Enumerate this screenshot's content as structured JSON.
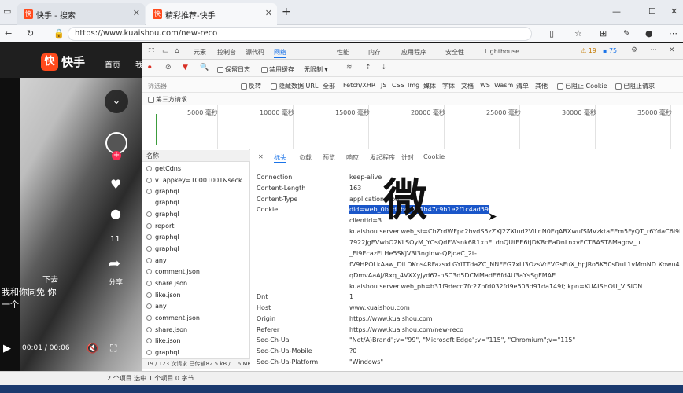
{
  "browser": {
    "tabs": [
      {
        "title": "快手 - 搜索",
        "active": false
      },
      {
        "title": "精彩推荐-快手",
        "active": true
      }
    ],
    "url": "https://www.kuaishou.com/new-reco"
  },
  "page": {
    "logo": "快手",
    "nav_home": "首页",
    "nav_partial": "我",
    "like_count": "11",
    "share_label": "分享",
    "subtitle_top": "下去",
    "subtitle_line1": "我和你同免 你",
    "subtitle_line2": "一个",
    "time": "00:01 / 00:06"
  },
  "devtools": {
    "tabs": [
      "元素",
      "控制台",
      "源代码",
      "网络",
      "性能",
      "内存",
      "应用程序",
      "安全性",
      "Lighthouse"
    ],
    "badges": {
      "warnings": "19",
      "issues": "75"
    },
    "toolbar": {
      "preserve_log": "保留日志",
      "disable_cache": "禁用缓存",
      "throttle": "无限制"
    },
    "filter": {
      "placeholder": "筛选器",
      "invert": "反转",
      "hide_data_urls": "隐藏数据 URL",
      "types": [
        "全部",
        "Fetch/XHR",
        "JS",
        "CSS",
        "Img",
        "媒体",
        "字体",
        "文档",
        "WS",
        "Wasm",
        "清单",
        "其他"
      ],
      "blocked_cookies": "已阻止 Cookie",
      "blocked_requests": "已阻止请求",
      "third_party": "第三方请求"
    },
    "timeline_ticks": [
      "5000 毫秒",
      "10000 毫秒",
      "15000 毫秒",
      "20000 毫秒",
      "25000 毫秒",
      "30000 毫秒",
      "35000 毫秒"
    ],
    "requests": {
      "header": "名称",
      "items": [
        "getCdns",
        "v1appkey=10001001&seck...",
        "graphql",
        "graphql",
        "graphql",
        "report",
        "graphql",
        "graphql",
        "any",
        "comment.json",
        "share.json",
        "like.json",
        "any",
        "comment.json",
        "share.json",
        "like.json",
        "graphql"
      ],
      "footer": "19 / 123 次请求  已传输82.5 kB / 1.6 MB"
    },
    "detail_tabs": [
      "标头",
      "负载",
      "预览",
      "响应",
      "发起程序",
      "计时",
      "Cookie"
    ],
    "headers": [
      {
        "k": "Connection",
        "v": "keep-alive"
      },
      {
        "k": "Content-Length",
        "v": "163"
      },
      {
        "k": "Content-Type",
        "v": "application/json"
      },
      {
        "k": "Cookie",
        "v": "did=web_0b0d6bec1a1b47c9b1e2f1c4ad59ec01d4bcc4d5b; clientid=3; didv=1691007389372; userId=1331884790; kpf=PC_WEB"
      },
      {
        "k": "",
        "v": "kuaishou.server.web_st=ChZrdWFpc2hvdS5zZXJ2ZXIud2ViLnN0EqABXwufSMVzktaEEm5FyQT_r6YdaC6i9kZm1zv"
      },
      {
        "k": "",
        "v": "7922JgEVwbO2KLSOyM_YOsQdFWsnk6R1xnELdnQUtEE6tjDK8cEaDnLnxvFCTBAST8Magov_u"
      },
      {
        "k": "",
        "v": "_El9EcazELHe5SKjV3l3nginw-QPjoaC_2t-"
      },
      {
        "k": "",
        "v": "fV9HPOLkAaw_DiLDKns4RFazsxLGYiTTdaZC_NNFEG7xLl3OzsVrFVGsFuX_hpJRo5K50sDuL1vMmND Xowu4Kx-"
      },
      {
        "k": "",
        "v": "qDmvAaAJ/Rxq_4VXXyjyd67-nSC3d5DCMMadE6fd4U3aYsSgFMAE"
      },
      {
        "k": "",
        "v": "kuaishou.server.web_ph=b31f9decc7fc27bfd032fd9e503d91da149f; kpn=KUAISHOU_VISION"
      },
      {
        "k": "Dnt",
        "v": "1"
      },
      {
        "k": "Host",
        "v": "www.kuaishou.com"
      },
      {
        "k": "Origin",
        "v": "https://www.kuaishou.com"
      },
      {
        "k": "Referer",
        "v": "https://www.kuaishou.com/new-reco"
      },
      {
        "k": "Sec-Ch-Ua",
        "v": "\"Not/A)Brand\";v=\"99\", \"Microsoft Edge\";v=\"115\", \"Chromium\";v=\"115\""
      },
      {
        "k": "Sec-Ch-Ua-Mobile",
        "v": "?0"
      },
      {
        "k": "Sec-Ch-Ua-Platform",
        "v": "\"Windows\""
      }
    ],
    "watermark": "微"
  },
  "statusbar": {
    "text": "2 个项目    选中 1 个项目 0 字节"
  },
  "colors": {
    "accent": "#1a73e8",
    "brand": "#ff4a1c",
    "selection": "#1a56c9"
  }
}
